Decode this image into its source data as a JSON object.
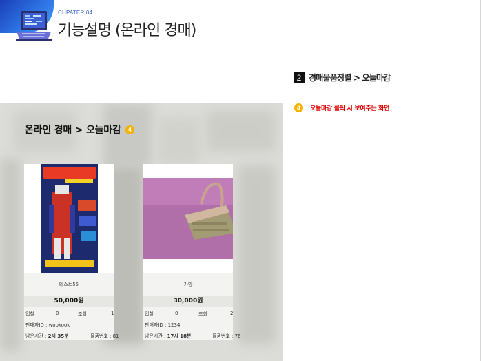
{
  "header": {
    "chapter_label": "CHPATER 04",
    "title": "기능설명 (온라인 경매)"
  },
  "section": {
    "number": "2",
    "heading": "경매물품정렬 > 오늘마감"
  },
  "note": {
    "badge": "4",
    "text": "오늘마감 클릭 시 보여주는 화면"
  },
  "screenshot": {
    "title": "온라인 경매 > 오늘마감",
    "badge": "4",
    "products": [
      {
        "name": "테스트55",
        "price": "50,000원",
        "bid_label": "입찰",
        "bid_value": "0",
        "view_label": "조회",
        "view_value": "1",
        "seller": "판매자ID : wookook",
        "remaining_label": "남은시간 :",
        "remaining_value": "2시 35분",
        "item_no": "물품번호 : 81"
      },
      {
        "name": "가방",
        "price": "30,000원",
        "bid_label": "입찰",
        "bid_value": "0",
        "view_label": "조회",
        "view_value": "2",
        "seller": "판매자ID : 1234",
        "remaining_label": "남은시간 :",
        "remaining_value": "17시 18분",
        "item_no": "물품번호 : 76"
      }
    ]
  },
  "colors": {
    "accent_blue": "#2f78e8",
    "badge_yellow": "#f2b400",
    "note_red": "#e00000"
  }
}
